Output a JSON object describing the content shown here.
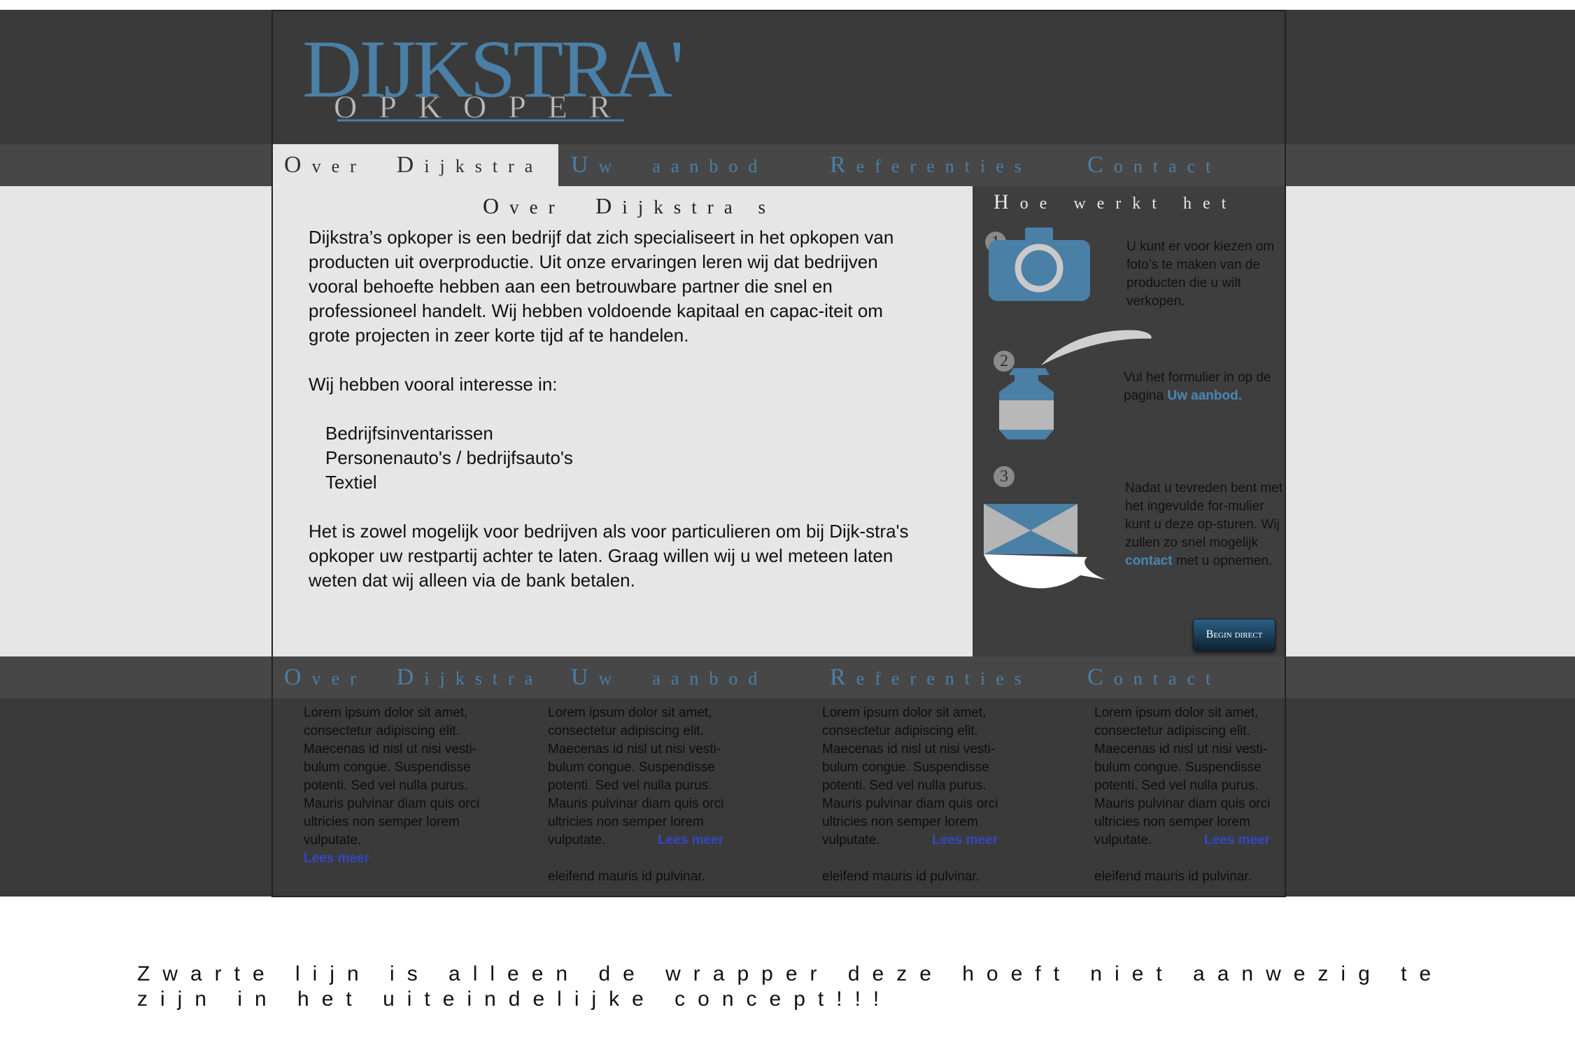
{
  "brand": {
    "logo_name": "DIJKSTRA'S",
    "logo_subtitle": "OPKOPER"
  },
  "colors": {
    "accent": "#4a7fa6",
    "header_bg": "#3a3a3a",
    "content_bg": "#e6e6e6",
    "sidebar_bg": "#3e3e3e",
    "link_blue": "#3347c4"
  },
  "nav": {
    "items": [
      {
        "first": "O",
        "rest": "ver",
        "word2_first": "D",
        "word2_rest": "ijkstra"
      },
      {
        "first": "U",
        "rest": "w",
        "word2_first": "",
        "word2_rest": "aanbod"
      },
      {
        "first": "R",
        "rest": "eferenties",
        "word2_first": "",
        "word2_rest": ""
      },
      {
        "first": "C",
        "rest": "ontact",
        "word2_first": "",
        "word2_rest": ""
      }
    ]
  },
  "main": {
    "title_first": "O",
    "title_rest": "ver",
    "title_word2_first": "D",
    "title_word2_rest": "ijkstra",
    "title_suffix": "s",
    "paragraph1": "Dijkstra’s opkoper is een bedrijf dat zich specialiseert in het opkopen van producten uit overproductie. Uit onze ervaringen leren wij dat bedrijven vooral behoefte hebben aan een betrouwbare partner die snel en professioneel handelt. Wij hebben voldoende kapitaal en capac-iteit om grote projecten in zeer korte tijd af te handelen.",
    "paragraph2": "Wij hebben vooral interesse in:",
    "interests": [
      "Bedrijfsinventarissen",
      "Personenauto's / bedrijfsauto's",
      "Textiel"
    ],
    "paragraph3": "Het is zowel mogelijk voor bedrijven als voor particulieren om bij Dijk-stra's opkoper uw restpartij achter te laten. Graag willen wij u wel meteen laten weten dat wij alleen via de bank betalen."
  },
  "sidebar": {
    "title_first": "H",
    "title_rest": "oe werkt het",
    "steps": [
      {
        "num": "1",
        "icon": "camera-icon",
        "text": "U kunt er voor kiezen om foto’s te maken van de producten die u wilt verkopen."
      },
      {
        "num": "2",
        "icon": "inkpot-quill-icon",
        "text_before": "Vul het formulier in op de pagina ",
        "link": "Uw aanbod."
      },
      {
        "num": "3",
        "icon": "envelope-icon",
        "text_before": "Nadat u tevreden bent met het ingevulde for-mulier kunt u deze op-sturen. Wij zullen zo snel mogelijk ",
        "link": "contact",
        "text_after": " met u opnemen."
      }
    ],
    "begin_button": "Begin direct"
  },
  "footer": {
    "columns": [
      {
        "text": "Lorem ipsum dolor sit amet, consectetur adipiscing elit. Maecenas id nisl ut nisi vesti-bulum congue. Suspendisse potenti. Sed vel nulla purus. Mauris pulvinar diam quis orci ultricies non semper lorem vulputate.",
        "link": "Lees meer",
        "extra": ""
      },
      {
        "text": "Lorem ipsum dolor sit amet, consectetur adipiscing elit. Maecenas id nisl ut nisi vesti-bulum congue. Suspendisse potenti. Sed vel nulla purus. Mauris pulvinar diam quis orci ultricies non semper lorem vulputate.",
        "link": "Lees meer",
        "extra": "eleifend mauris id pulvinar."
      },
      {
        "text": "Lorem ipsum dolor sit amet, consectetur adipiscing elit. Maecenas id nisl ut nisi vesti-bulum congue. Suspendisse potenti. Sed vel nulla purus. Mauris pulvinar diam quis orci ultricies non semper lorem vulputate.",
        "link": "Lees meer",
        "extra": "eleifend mauris id pulvinar."
      },
      {
        "text": "Lorem ipsum dolor sit amet, consectetur adipiscing elit. Maecenas id nisl ut nisi vesti-bulum congue. Suspendisse potenti. Sed vel nulla purus. Mauris pulvinar diam quis orci ultricies non semper lorem vulputate.",
        "link": "Lees meer",
        "extra": "eleifend mauris id pulvinar."
      }
    ]
  },
  "note": "Zwarte lijn is alleen de wrapper deze hoeft niet aanwezig te zijn in het uiteindelijke concept!!!"
}
